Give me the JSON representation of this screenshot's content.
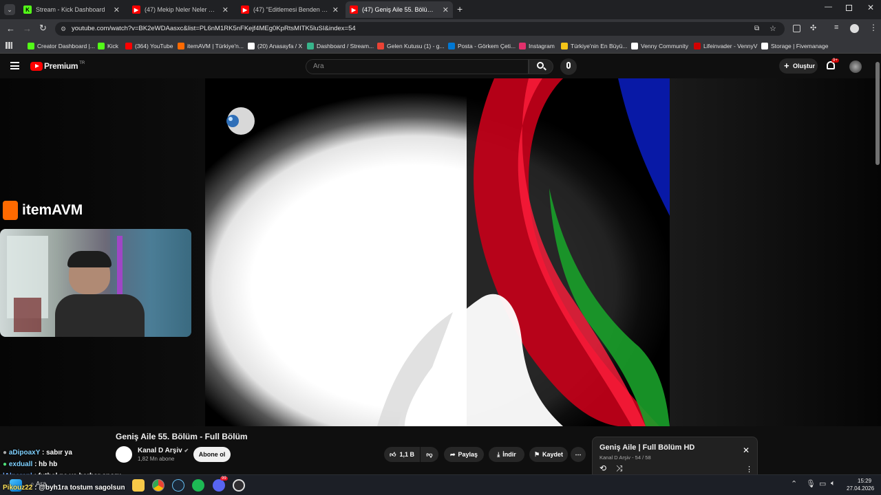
{
  "tabs": [
    {
      "label": "Stream - Kick Dashboard",
      "color": "#53fc18",
      "active": false
    },
    {
      "label": "(47) Mekip Neler Neler 67.Bölüm",
      "color": "#ff0000",
      "active": false
    },
    {
      "label": "(47) \"Editlemesi Benden Like Ar",
      "color": "#ff0000",
      "active": false
    },
    {
      "label": "(47) Geniş Aile 55. Bölüm - Full",
      "color": "#ff0000",
      "active": true
    }
  ],
  "address": {
    "url": "youtube.com/watch?v=BK2eWDAasxc&list=PL6nM1RK5nFKejf4MEg0KpRtsMITK5luSI&index=54"
  },
  "bookmarks": [
    {
      "label": "Creator Dashboard |...",
      "color": "#53fc18"
    },
    {
      "label": "Kick",
      "color": "#53fc18"
    },
    {
      "label": "(364) YouTube",
      "color": "#ff0000"
    },
    {
      "label": "itemAVM | Türkiye'n...",
      "color": "#ff6a00"
    },
    {
      "label": "(20) Anasayfa / X",
      "color": "#ffffff"
    },
    {
      "label": "Dashboard / Stream...",
      "color": "#38b48b"
    },
    {
      "label": "Gelen Kutusu (1) - g...",
      "color": "#ea4335"
    },
    {
      "label": "Posta - Görkem Çeti...",
      "color": "#0078d4"
    },
    {
      "label": "Instagram",
      "color": "#e1306c"
    },
    {
      "label": "Türkiye'nin En Büyü...",
      "color": "#f5c518"
    },
    {
      "label": "Venny Community",
      "color": "#ffffff"
    },
    {
      "label": "Lifeinvader - VennyV",
      "color": "#d00000"
    },
    {
      "label": "Storage | Fivemanage",
      "color": "#ffffff"
    }
  ],
  "youtube": {
    "logo": "Premium",
    "region": "TR",
    "search_placeholder": "Ara",
    "create_label": "Oluştur",
    "notif_badge": "9+"
  },
  "overlay": {
    "brand": "itemAVM"
  },
  "chat": [
    {
      "user": "aDipoaxY",
      "text": ": sabır ya",
      "color": "#7fd1ff"
    },
    {
      "user": "exduall",
      "text": ": hb hb",
      "color": "#7fd1ff"
    },
    {
      "user": "lAlperenl",
      "text": ": futbol ne ya barbar sporu",
      "color": "#6fa8ff"
    },
    {
      "user": "Pikouz22",
      "text": ": @byh1ra tostum sagolsun",
      "color": "#ffe25a"
    }
  ],
  "video": {
    "title": "Geniş Aile 55. Bölüm - Full Bölüm",
    "channel": "Kanal D Arşiv",
    "subscribers": "1,82 Mn abone",
    "subscribe_label": "Abone ol",
    "likes": "1,1 B",
    "share_label": "Paylaş",
    "download_label": "İndir",
    "save_label": "Kaydet"
  },
  "playlist": {
    "title": "Geniş Aile | Full Bölüm HD",
    "meta": "Kanal D Arşiv - 54 / 58"
  },
  "taskbar": {
    "search_label": "Ara",
    "time": "15:29",
    "date": "27.04.2026",
    "discord_badge": "99"
  }
}
